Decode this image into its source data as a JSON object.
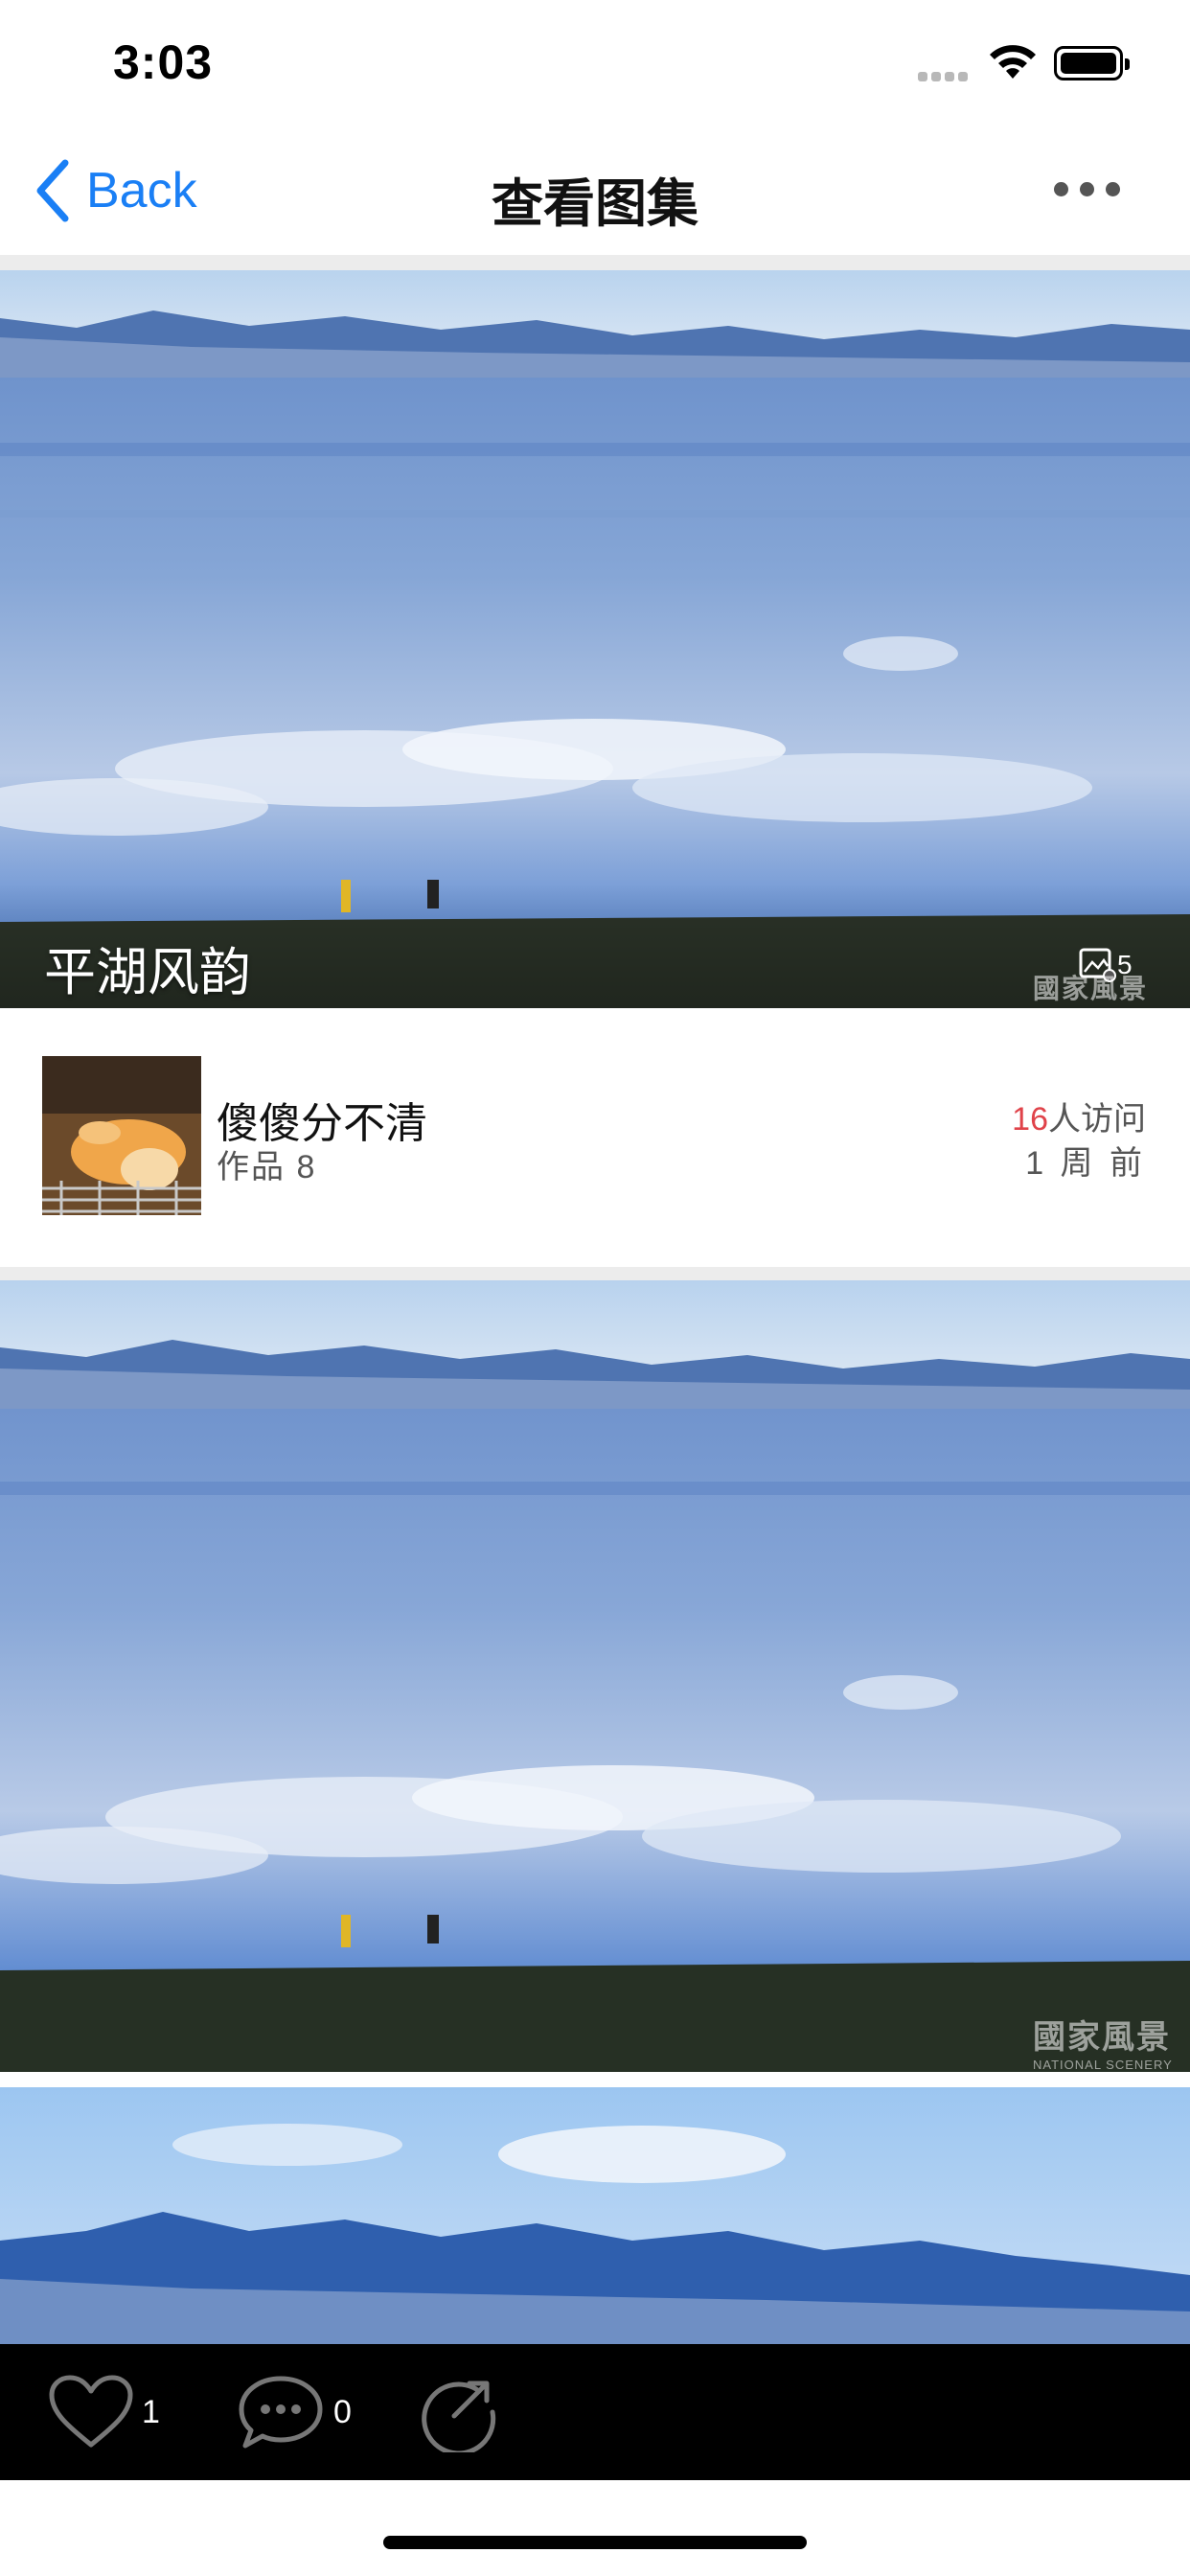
{
  "status_bar": {
    "time": "3:03"
  },
  "nav": {
    "back_label": "Back",
    "title": "查看图集"
  },
  "cover": {
    "caption": "平湖风韵",
    "photo_count": "5",
    "watermark": "國家風景"
  },
  "author": {
    "name": "傻傻分不清",
    "works": "作品 8",
    "visit_count": "16",
    "visit_suffix": "人访问",
    "time_ago": "1 周 前"
  },
  "photo2": {
    "watermark": "國家風景",
    "watermark_sub": "NATIONAL SCENERY"
  },
  "toolbar": {
    "likes": "1",
    "comments": "0"
  },
  "colors": {
    "accent": "#1a7ff5",
    "visit_red": "#e0434a",
    "toolbar_bg": "#000000"
  }
}
